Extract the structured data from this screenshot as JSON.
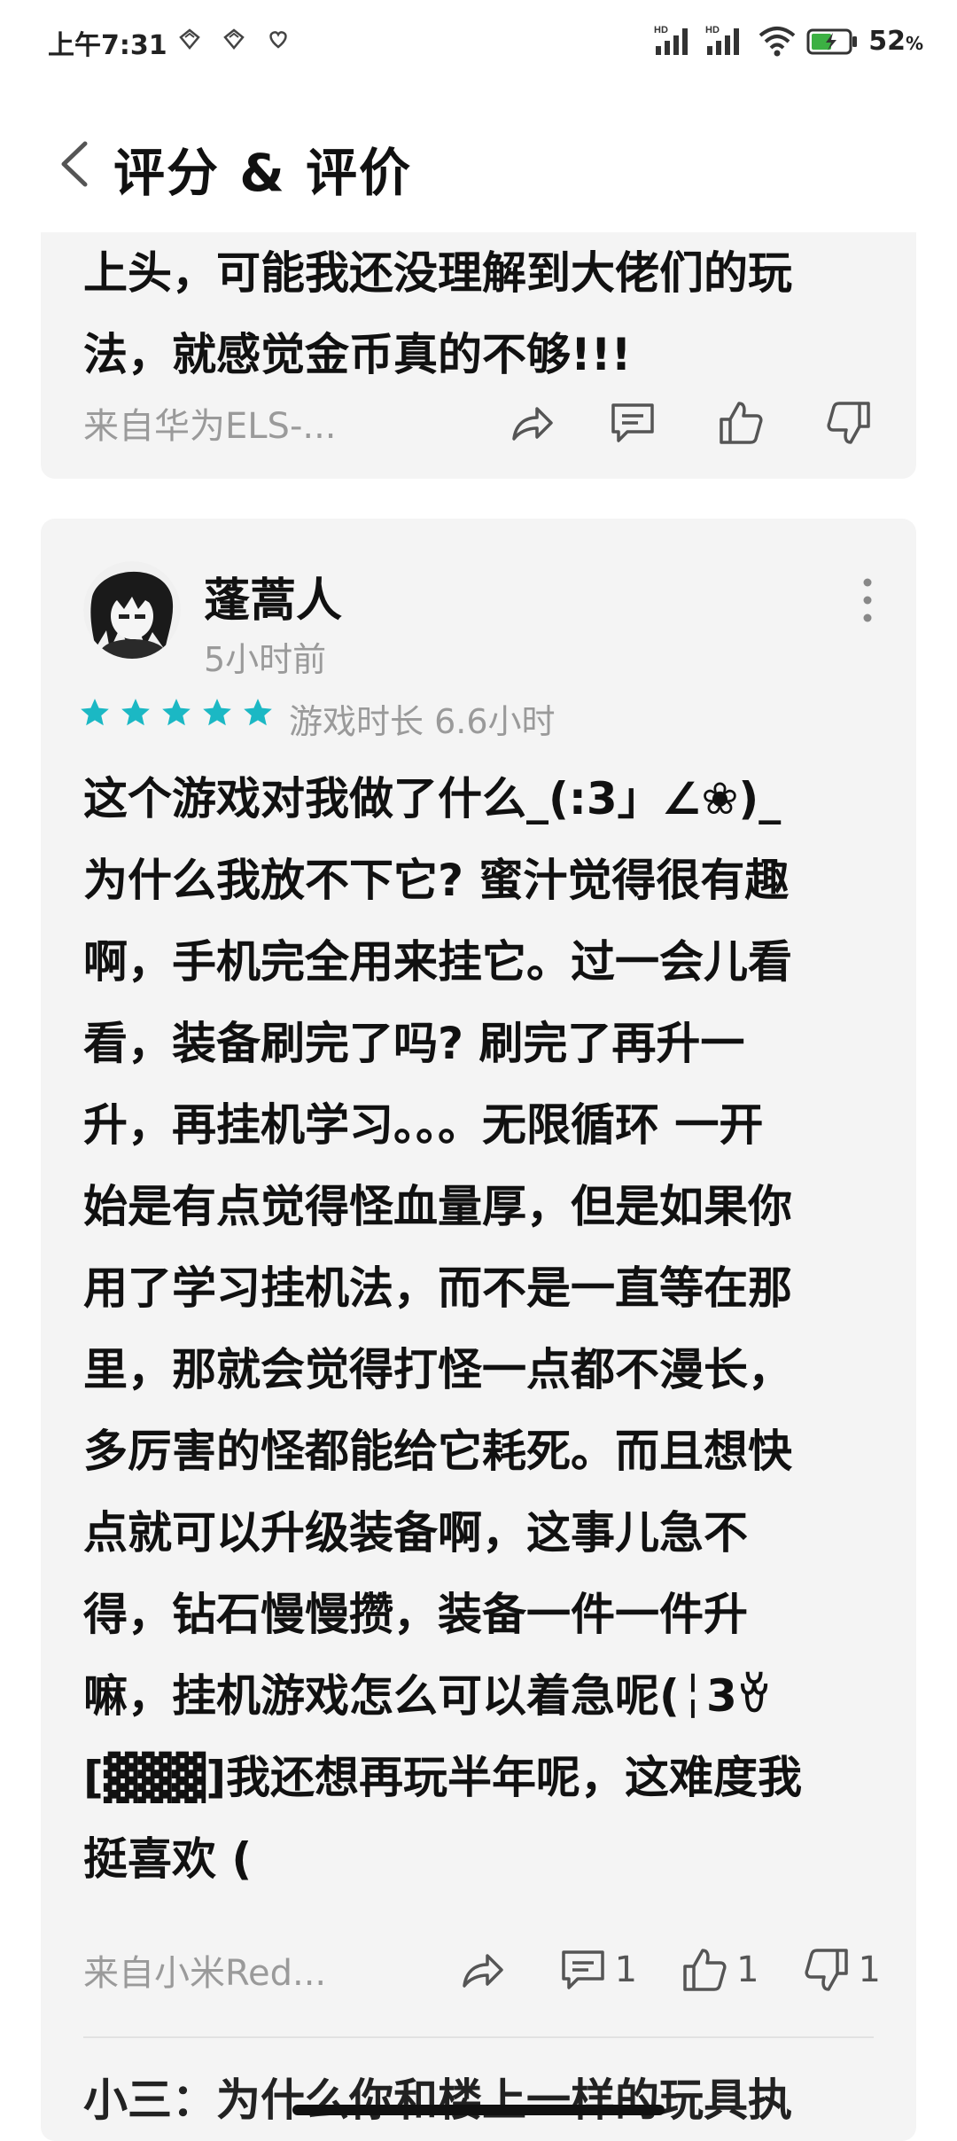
{
  "status_bar": {
    "time": "上午7:31",
    "battery_percent": "52",
    "battery_unit": "%",
    "icons": [
      "notification-icon",
      "notification-icon",
      "heart-icon",
      "signal-hd-icon",
      "signal-hd-icon",
      "wifi-icon",
      "battery-charging-icon"
    ]
  },
  "header": {
    "title": "评分 & 评价",
    "back_icon": "chevron-left-icon"
  },
  "reviews": [
    {
      "body": "上头，可能我还没理解到大佬们的玩\n法，就感觉金币真的不够!!!",
      "source": "来自华为ELS-...",
      "counts": {
        "comments": "",
        "likes": "",
        "dislikes": ""
      }
    },
    {
      "username": "蓬蒿人",
      "time_ago": "5小时前",
      "rating": 5,
      "playtime": "游戏时长 6.6小时",
      "body": "这个游戏对我做了什么_(:3」∠❀)_\n为什么我放不下它? 蜜汁觉得很有趣\n啊，手机完全用来挂它。过一会儿看\n看，装备刷完了吗? 刷完了再升一\n升，再挂机学习。。。无限循环 一开\n始是有点觉得怪血量厚，但是如果你\n用了学习挂机法，而不是一直等在那\n里，那就会觉得打怪一点都不漫长，\n多厉害的怪都能给它耗死。而且想快\n点就可以升级装备啊，这事儿急不\n得，钻石慢慢攒，装备一件一件升\n嘛，挂机游戏怎么可以着急呢(╎3ꈊ\n[▓▓▓]我还想再玩半年呢，这难度我\n挺喜欢 (",
      "source": "来自小米Red...",
      "counts": {
        "comments": "1",
        "likes": "1",
        "dislikes": "1"
      },
      "reply_preview": "小三：为什么你和楼上一样的玩具执"
    }
  ],
  "colors": {
    "card_bg": "#f4f4f4",
    "star": "#1bb8c4",
    "muted_text": "#9a9a9a"
  }
}
